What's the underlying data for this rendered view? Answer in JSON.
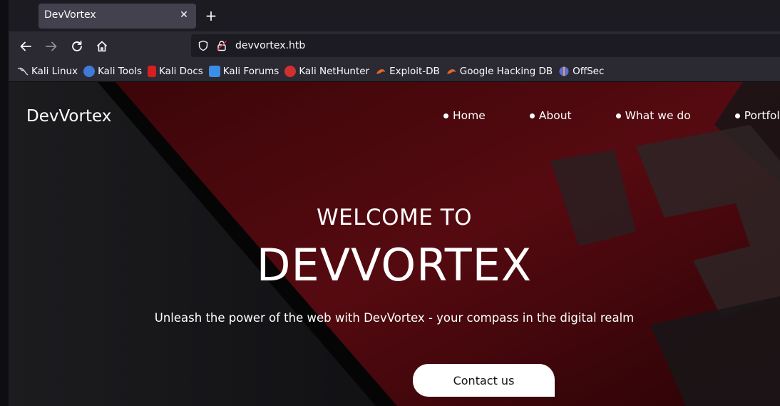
{
  "browser": {
    "tab": {
      "title": "DevVortex",
      "close_glyph": "✕"
    },
    "new_tab_glyph": "+",
    "url": "devvortex.htb",
    "nav_icons": [
      "back-arrow-icon",
      "forward-arrow-icon",
      "reload-icon",
      "home-icon",
      "shield-icon",
      "insecure-lock-icon"
    ],
    "bookmarks": [
      {
        "label": "Kali Linux",
        "icon": "kali-dragon-icon",
        "color": "#cfd8e3"
      },
      {
        "label": "Kali Tools",
        "icon": "kali-tools-icon",
        "color": "#3e7bd8"
      },
      {
        "label": "Kali Docs",
        "icon": "kali-docs-icon",
        "color": "#d32020"
      },
      {
        "label": "Kali Forums",
        "icon": "kali-forums-icon",
        "color": "#3a8ee6"
      },
      {
        "label": "Kali NetHunter",
        "icon": "kali-nethunter-icon",
        "color": "#d03030"
      },
      {
        "label": "Exploit-DB",
        "icon": "exploit-db-icon",
        "color": "#e0662a"
      },
      {
        "label": "Google Hacking DB",
        "icon": "ghdb-icon",
        "color": "#e0662a"
      },
      {
        "label": "OffSec",
        "icon": "offsec-icon",
        "color": "#5a6ee0"
      }
    ]
  },
  "site": {
    "logo": "DevVortex",
    "nav": [
      "Home",
      "About",
      "What we do",
      "Portfolio"
    ],
    "welcome": "WELCOME TO",
    "brand": "DEVVORTEX",
    "tagline": "Unleash the power of the web with DevVortex - your compass in the digital realm",
    "contact_label": "Contact us"
  },
  "colors": {
    "tab_bg": "#42414d",
    "toolbar_bg": "#2b2a33",
    "urlbar_bg": "#1c1b22",
    "hero_accent": "#5a0a10"
  }
}
